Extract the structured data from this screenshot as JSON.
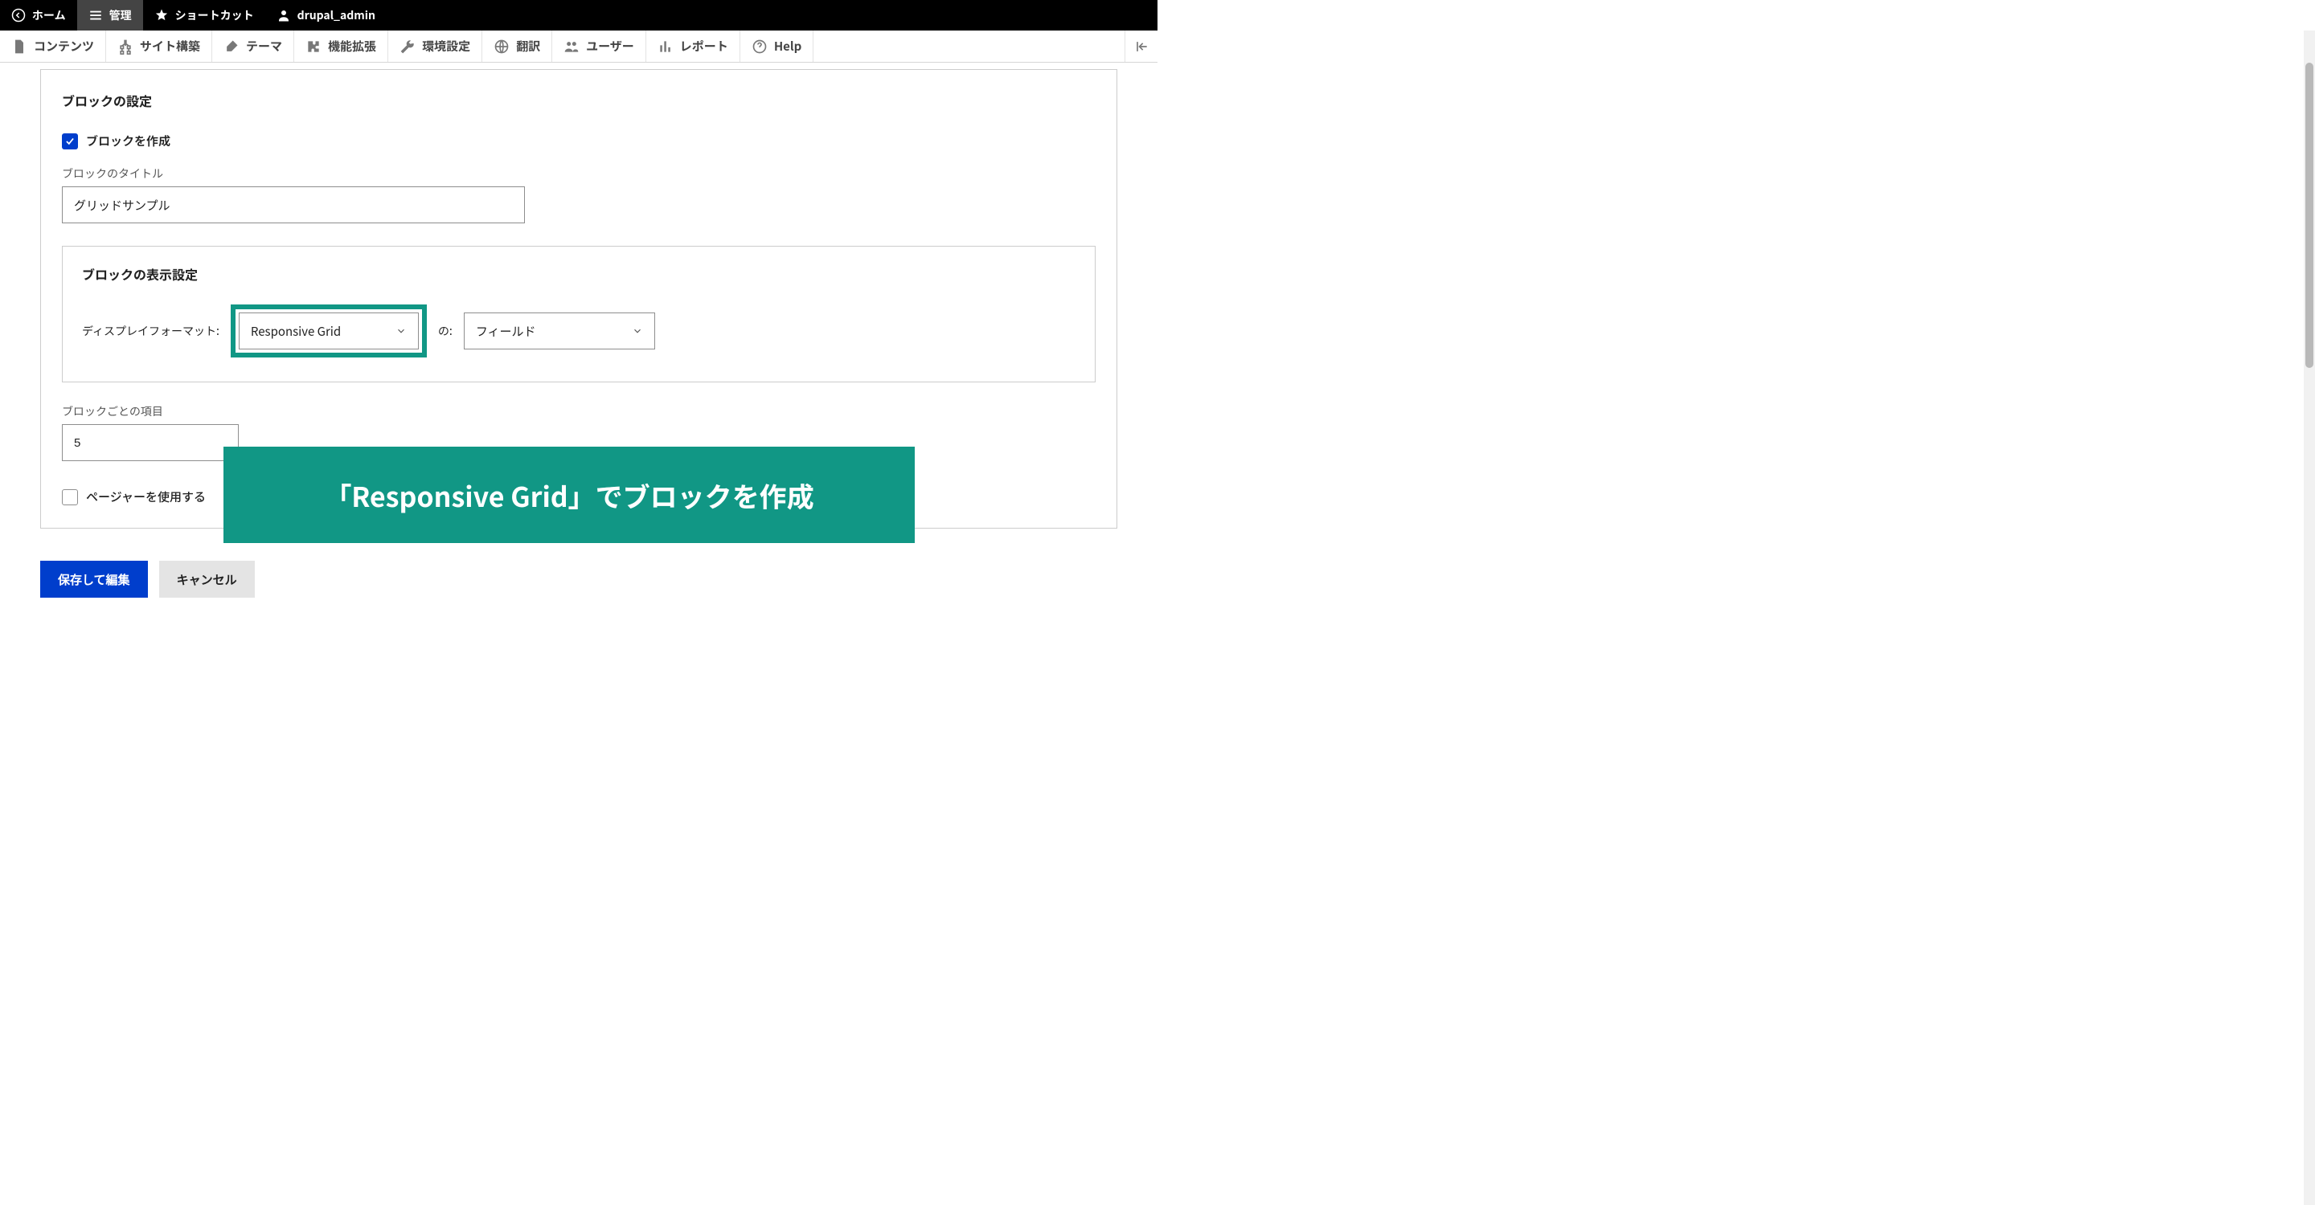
{
  "topbar": {
    "home": "ホーム",
    "manage": "管理",
    "shortcuts": "ショートカット",
    "user": "drupal_admin"
  },
  "adminMenu": {
    "content": "コンテンツ",
    "structure": "サイト構築",
    "appearance": "テーマ",
    "extend": "機能拡張",
    "config": "環境設定",
    "translate": "翻訳",
    "people": "ユーザー",
    "reports": "レポート",
    "help": "Help"
  },
  "panel": {
    "title": "ブロックの設定",
    "createBlockLabel": "ブロックを作成",
    "blockTitleLabel": "ブロックのタイトル",
    "blockTitleValue": "グリッドサンプル"
  },
  "display": {
    "title": "ブロックの表示設定",
    "formatLabel": "ディスプレイフォーマット:",
    "formatValue": "Responsive Grid",
    "ofLabel": "の:",
    "ofValue": "フィールド"
  },
  "items": {
    "label": "ブロックごとの項目",
    "value": "5"
  },
  "pager": {
    "label": "ページャーを使用する"
  },
  "overlayText": "「Responsive Grid」でブロックを作成",
  "buttons": {
    "save": "保存して編集",
    "cancel": "キャンセル"
  }
}
